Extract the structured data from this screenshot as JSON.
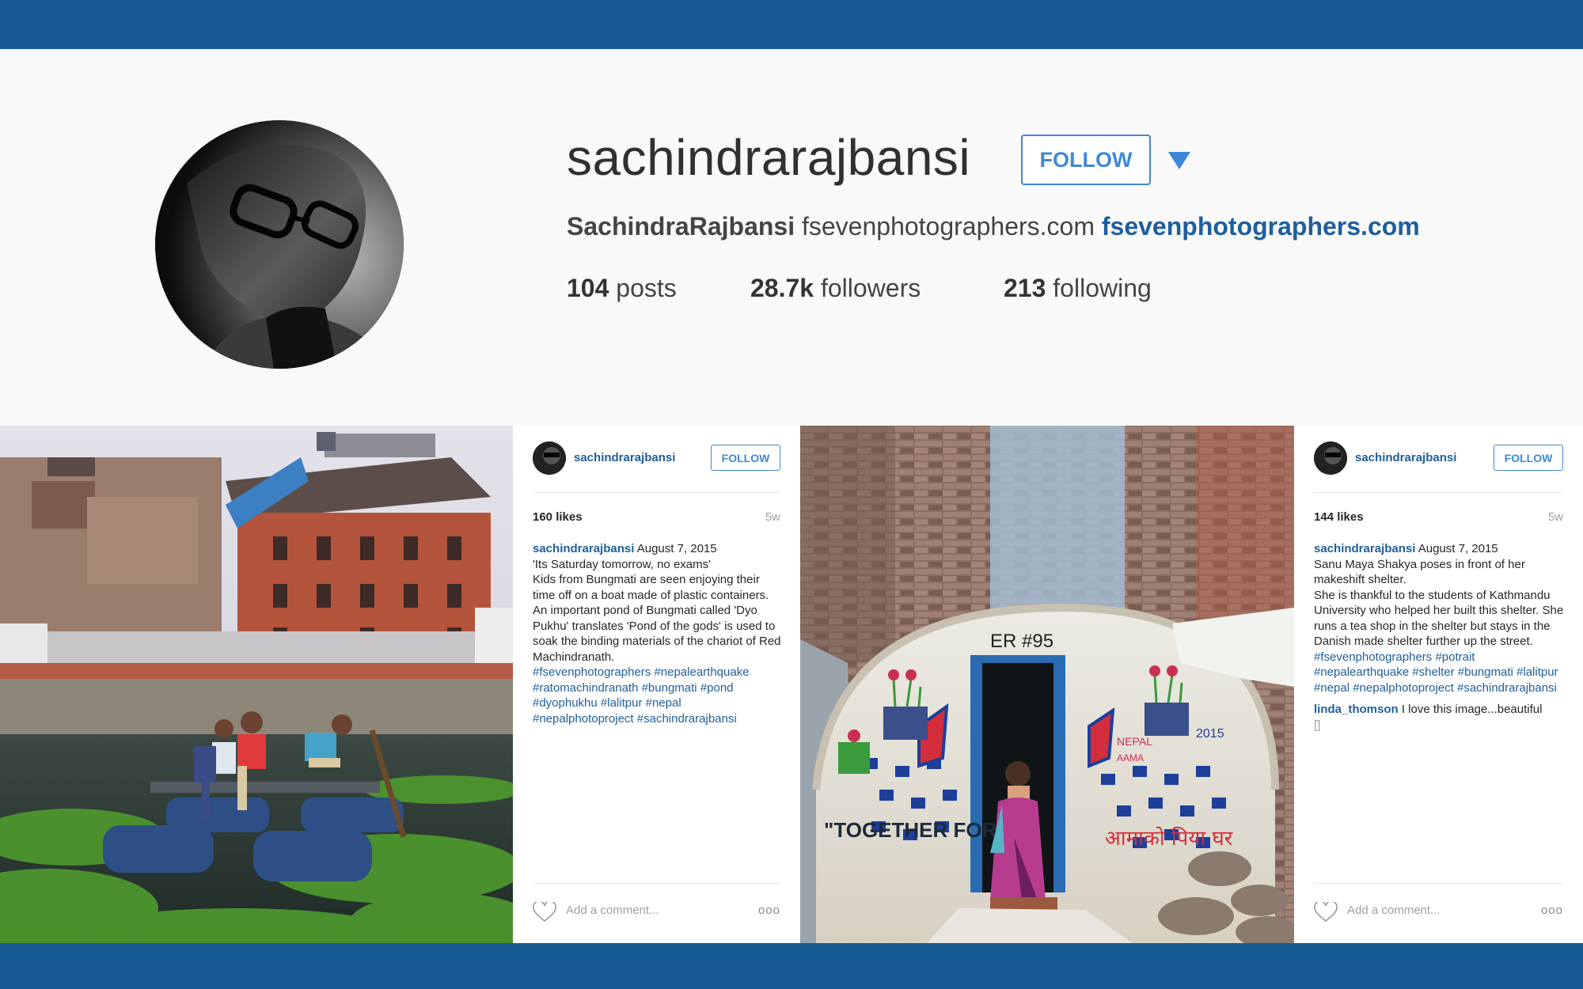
{
  "profile": {
    "username": "sachindrarajbansi",
    "follow_label": "FOLLOW",
    "display_name": "SachindraRajbansi",
    "bio_text": "fsevenphotographers.com",
    "website": "fsevenphotographers.com",
    "posts_count": "104",
    "posts_label": "posts",
    "followers_count": "28.7k",
    "followers_label": "followers",
    "following_count": "213",
    "following_label": "following"
  },
  "posts": [
    {
      "username": "sachindrarajbansi",
      "follow_label": "FOLLOW",
      "likes": "160 likes",
      "age": "5w",
      "date": "August 7, 2015",
      "caption_lines": [
        "'Its Saturday tomorrow, no exams'",
        "Kids from Bungmati are seen enjoying their time off on a boat made of plastic containers.",
        "An important pond of Bungmati called 'Dyo Pukhu' translates 'Pond of the gods' is used to soak the binding materials of the chariot of Red Machindranath."
      ],
      "tags": "#fsevenphotographers #nepalearthquake #ratomachindranath #bungmati #pond #dyophukhu #lalitpur #nepal #nepalphotoproject #sachindrarajbansi",
      "add_comment_placeholder": "Add a comment...",
      "more_label": "ooo"
    },
    {
      "username": "sachindrarajbansi",
      "follow_label": "FOLLOW",
      "likes": "144 likes",
      "age": "5w",
      "date": "August 7, 2015",
      "caption_lines": [
        "Sanu Maya Shakya poses in front of her makeshift shelter.",
        "She is thankful to the students of Kathmandu University who helped her built this shelter. She runs a tea shop in the shelter but stays in the Danish made shelter further up the street."
      ],
      "tags": "#fsevenphotographers #potrait #nepalearthquake #shelter #bungmati #lalitpur #nepal #nepalphotoproject #sachindrarajbansi",
      "comment_user": "linda_thomson",
      "comment_text": "I love this image...beautiful",
      "comment_extra": "[]",
      "add_comment_placeholder": "Add a comment...",
      "more_label": "ooo"
    }
  ],
  "images": {
    "photo1_wall_text": "",
    "photo2_door_text": "ER #95",
    "photo2_left_text": "\"TOGETHER FOR",
    "photo2_nepal_text": "NEPAL",
    "photo2_aama_text": "AAMA",
    "photo2_year_text": "2015",
    "photo2_hindi_text": "आमाको पिया घर"
  },
  "colors": {
    "brand_blue": "#175b92",
    "link_blue": "#1f5e9c",
    "follow_blue": "#3f88d8"
  }
}
